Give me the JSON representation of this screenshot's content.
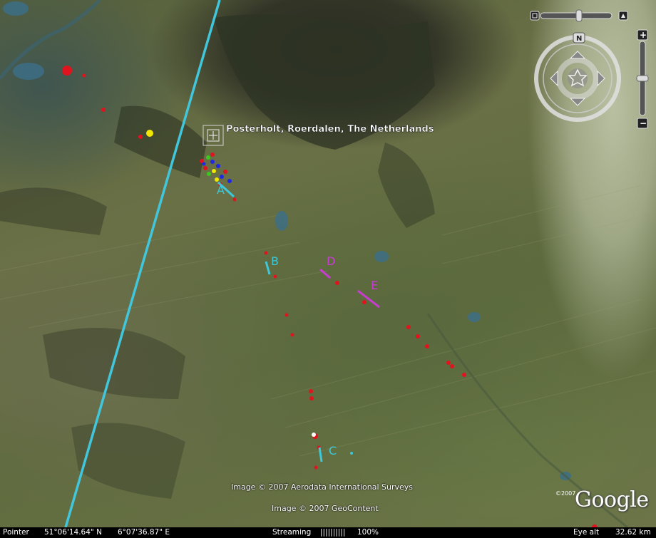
{
  "map": {
    "placemark_label": "Posterholt, Roerdalen, The Netherlands",
    "markers": {
      "A": "A",
      "B": "B",
      "C": "C",
      "D": "D",
      "E": "E"
    },
    "colors": {
      "track_line": "#41c6db",
      "cyan_marker": "#3cc8d8",
      "magenta_marker": "#c83cd2",
      "red_dot": "#e0141e",
      "yellow_dot": "#f0e600",
      "blue_dot": "#1e28e6",
      "green_dot": "#3cc81e"
    }
  },
  "credits": {
    "aerodata": "Image © 2007 Aerodata International Surveys",
    "geocontent": "Image © 2007 GeoContent",
    "logo": "Google",
    "logo_copyright": "©2007"
  },
  "nav": {
    "north_label": "N",
    "zoom_in": "+",
    "zoom_out": "−"
  },
  "statusbar": {
    "pointer_label": "Pointer",
    "latitude": "51°06'14.64\" N",
    "longitude": "6°07'36.87\" E",
    "streaming_label": "Streaming",
    "streaming_bar": "||||||||||",
    "streaming_percent": "100%",
    "eye_alt_label": "Eye alt",
    "eye_alt_value": "32.62 km"
  }
}
